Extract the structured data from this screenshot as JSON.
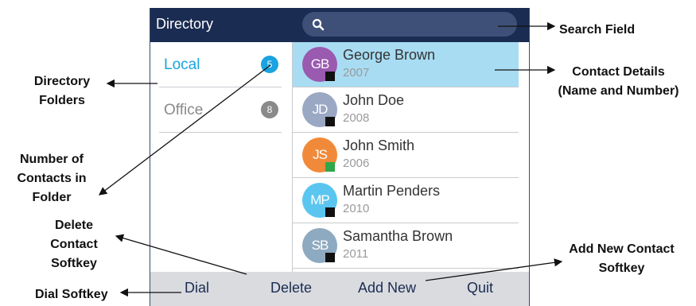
{
  "header": {
    "title": "Directory",
    "search_icon": "search-icon"
  },
  "folders": [
    {
      "label": "Local",
      "count": "5",
      "label_color": "#1aa3e0",
      "badge_color": "#1aa3e0"
    },
    {
      "label": "Office",
      "count": "8",
      "label_color": "#8a8a8a",
      "badge_color": "#8a8a8a"
    }
  ],
  "contacts": [
    {
      "initials": "GB",
      "name": "George Brown",
      "number": "2007",
      "avatar_color": "#9a5ab0",
      "status_color": "#111111",
      "selected": true
    },
    {
      "initials": "JD",
      "name": "John Doe",
      "number": "2008",
      "avatar_color": "#9aa8c4",
      "status_color": "#111111"
    },
    {
      "initials": "JS",
      "name": "John Smith",
      "number": "2006",
      "avatar_color": "#f08a3a",
      "status_color": "#2fa84a"
    },
    {
      "initials": "MP",
      "name": "Martin Penders",
      "number": "2010",
      "avatar_color": "#5ac6f0",
      "status_color": "#111111"
    },
    {
      "initials": "SB",
      "name": "Samantha Brown",
      "number": "2011",
      "avatar_color": "#8eaac0",
      "status_color": "#111111"
    }
  ],
  "softkeys": {
    "dial": "Dial",
    "delete": "Delete",
    "add_new": "Add New",
    "quit": "Quit"
  },
  "callouts": {
    "directory_folders": [
      "Directory",
      "Folders"
    ],
    "number_of_contacts": [
      "Number of",
      "Contacts in",
      "Folder"
    ],
    "delete_softkey": [
      "Delete",
      "Contact",
      "Softkey"
    ],
    "dial_softkey": "Dial Softkey",
    "search_field": "Search Field",
    "contact_details": [
      "Contact Details",
      "(Name and Number)"
    ],
    "add_new_softkey": [
      "Add New Contact",
      "Softkey"
    ]
  },
  "colors": {
    "header_bg": "#1b2c52",
    "selected_row": "#a8dcf2",
    "softkey_bar": "#d9dbdf"
  }
}
